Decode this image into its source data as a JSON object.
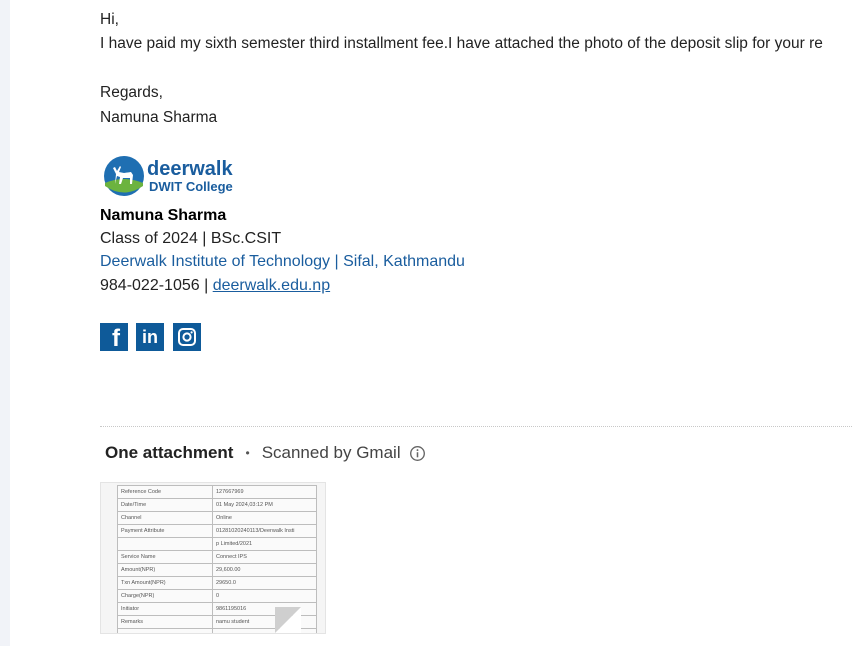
{
  "email": {
    "greeting": "Hi,",
    "body": "I have paid my sixth semester third installment fee.I have attached the photo of the deposit slip for your re",
    "closing": "Regards,",
    "sender": "Namuna Sharma"
  },
  "signature": {
    "logo": {
      "title": "deerwalk",
      "subtitle": "DWIT College"
    },
    "name": "Namuna Sharma",
    "class_info": "Class of 2024 | BSc.CSIT",
    "institute": "Deerwalk Institute of Technology | Sifal, Kathmandu",
    "phone": "984-022-1056 | ",
    "website": "deerwalk.edu.np",
    "social": [
      {
        "icon": "facebook-icon",
        "glyph": "f"
      },
      {
        "icon": "linkedin-icon",
        "glyph": "in"
      },
      {
        "icon": "instagram-icon"
      }
    ],
    "brand_color": "#0e5a99"
  },
  "attachments": {
    "count_label": "One attachment",
    "separator": "•",
    "scan_label": "Scanned by Gmail",
    "thumbnail_rows": [
      [
        "Reference Code",
        "127667969"
      ],
      [
        "Date/Time",
        "01 May 2024,03:12 PM"
      ],
      [
        "Channel",
        "Online"
      ],
      [
        "Payment Attribute",
        "01281020240113/Deerwalk Insti"
      ],
      [
        "",
        "p Limited/2021"
      ],
      [
        "Service Name",
        "Connect IPS"
      ],
      [
        "Amount(NPR)",
        "29,600.00"
      ],
      [
        "Txn Amount(NPR)",
        "29650.0"
      ],
      [
        "Charge(NPR)",
        "0"
      ],
      [
        "Initiator",
        "9861195016"
      ],
      [
        "Remarks",
        "namu student"
      ],
      [
        "",
        ""
      ]
    ]
  }
}
